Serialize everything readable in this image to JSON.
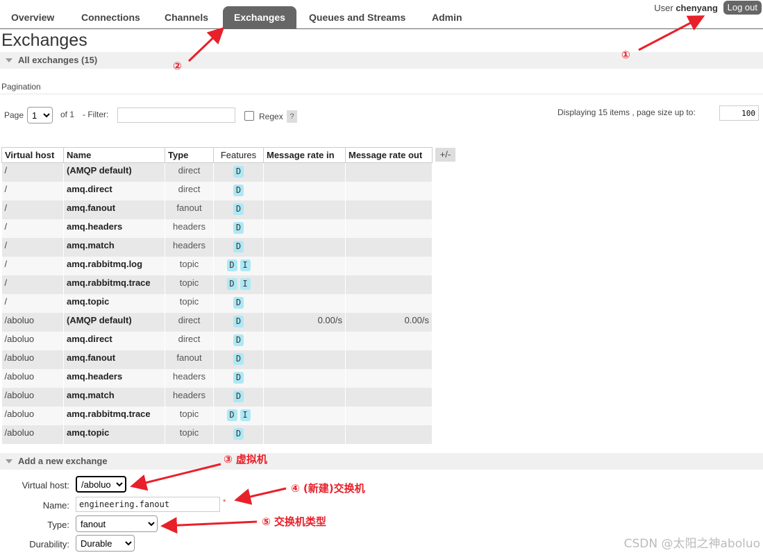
{
  "nav": {
    "tabs": [
      "Overview",
      "Connections",
      "Channels",
      "Exchanges",
      "Queues and Streams",
      "Admin"
    ],
    "user_prefix": "User",
    "username": "chenyang",
    "logout": "Log out"
  },
  "page_title": "Exchanges",
  "all_exchanges": {
    "label": "All exchanges (15)"
  },
  "pagination": {
    "label": "Pagination",
    "page_label": "Page",
    "page_value": "1",
    "of_label": "of 1",
    "filter_label": "- Filter:",
    "filter_value": "",
    "regex_label": "Regex",
    "help": "?",
    "displaying": "Displaying 15 items , page size up to:",
    "page_size": "100"
  },
  "table": {
    "columns": [
      "Virtual host",
      "Name",
      "Type",
      "Features",
      "Message rate in",
      "Message rate out"
    ],
    "toggle": "+/-",
    "rows": [
      {
        "vhost": "/",
        "name": "(AMQP default)",
        "type": "direct",
        "features": [
          "D"
        ],
        "rate_in": "",
        "rate_out": ""
      },
      {
        "vhost": "/",
        "name": "amq.direct",
        "type": "direct",
        "features": [
          "D"
        ],
        "rate_in": "",
        "rate_out": ""
      },
      {
        "vhost": "/",
        "name": "amq.fanout",
        "type": "fanout",
        "features": [
          "D"
        ],
        "rate_in": "",
        "rate_out": ""
      },
      {
        "vhost": "/",
        "name": "amq.headers",
        "type": "headers",
        "features": [
          "D"
        ],
        "rate_in": "",
        "rate_out": ""
      },
      {
        "vhost": "/",
        "name": "amq.match",
        "type": "headers",
        "features": [
          "D"
        ],
        "rate_in": "",
        "rate_out": ""
      },
      {
        "vhost": "/",
        "name": "amq.rabbitmq.log",
        "type": "topic",
        "features": [
          "D",
          "I"
        ],
        "rate_in": "",
        "rate_out": ""
      },
      {
        "vhost": "/",
        "name": "amq.rabbitmq.trace",
        "type": "topic",
        "features": [
          "D",
          "I"
        ],
        "rate_in": "",
        "rate_out": ""
      },
      {
        "vhost": "/",
        "name": "amq.topic",
        "type": "topic",
        "features": [
          "D"
        ],
        "rate_in": "",
        "rate_out": ""
      },
      {
        "vhost": "/aboluo",
        "name": "(AMQP default)",
        "type": "direct",
        "features": [
          "D"
        ],
        "rate_in": "0.00/s",
        "rate_out": "0.00/s"
      },
      {
        "vhost": "/aboluo",
        "name": "amq.direct",
        "type": "direct",
        "features": [
          "D"
        ],
        "rate_in": "",
        "rate_out": ""
      },
      {
        "vhost": "/aboluo",
        "name": "amq.fanout",
        "type": "fanout",
        "features": [
          "D"
        ],
        "rate_in": "",
        "rate_out": ""
      },
      {
        "vhost": "/aboluo",
        "name": "amq.headers",
        "type": "headers",
        "features": [
          "D"
        ],
        "rate_in": "",
        "rate_out": ""
      },
      {
        "vhost": "/aboluo",
        "name": "amq.match",
        "type": "headers",
        "features": [
          "D"
        ],
        "rate_in": "",
        "rate_out": ""
      },
      {
        "vhost": "/aboluo",
        "name": "amq.rabbitmq.trace",
        "type": "topic",
        "features": [
          "D",
          "I"
        ],
        "rate_in": "",
        "rate_out": ""
      },
      {
        "vhost": "/aboluo",
        "name": "amq.topic",
        "type": "topic",
        "features": [
          "D"
        ],
        "rate_in": "",
        "rate_out": ""
      }
    ]
  },
  "add_exchange": {
    "label": "Add a new exchange",
    "vhost_label": "Virtual host:",
    "vhost_value": "/aboluo",
    "name_label": "Name:",
    "name_value": "engineering.fanout",
    "required": "*",
    "type_label": "Type:",
    "type_value": "fanout",
    "durability_label": "Durability:",
    "durability_value": "Durable"
  },
  "annotations": {
    "a1": "①",
    "a2": "②",
    "a3": "③ 虚拟机",
    "a4": "④ (新建)交换机",
    "a5": "⑤ 交换机类型",
    "color": "#e8202a"
  },
  "watermark": "CSDN @太阳之神aboluo",
  "colors": {
    "tab_active": "#666666",
    "badge": "#aee8f5",
    "row_odd": "#e8e8e8",
    "row_even": "#f7f7f7"
  }
}
